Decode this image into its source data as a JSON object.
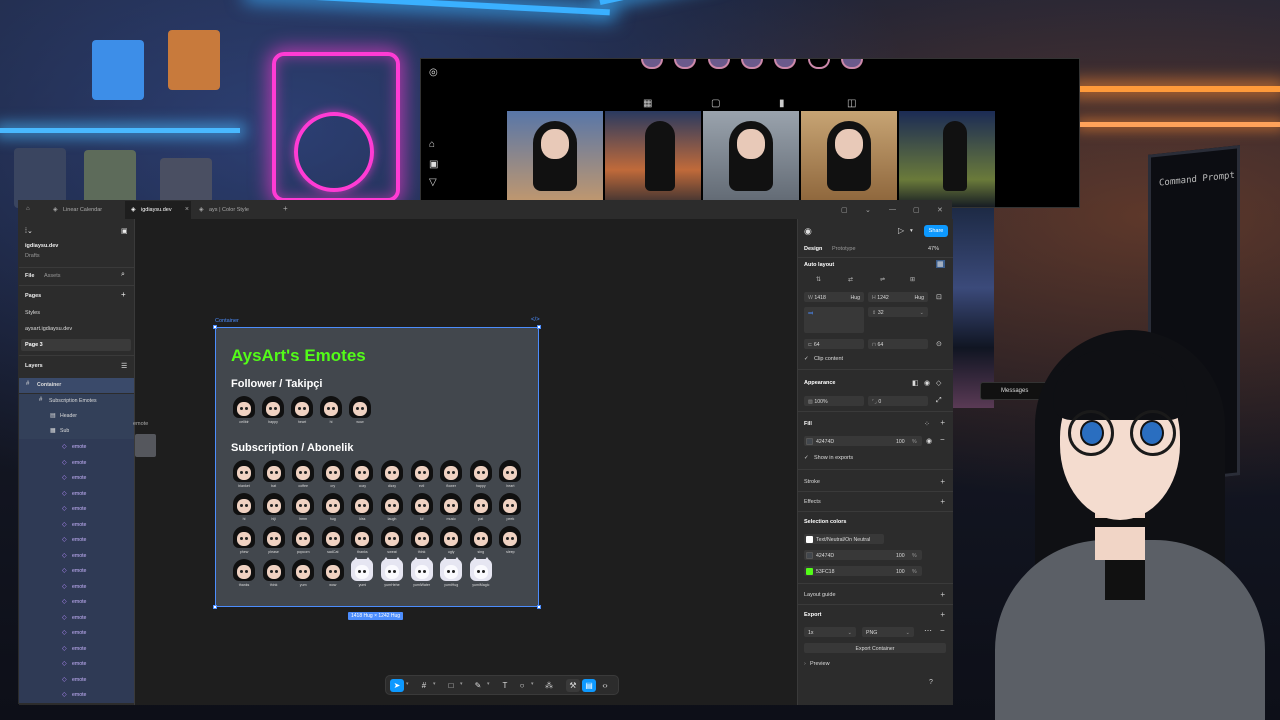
{
  "figma": {
    "tabs": [
      {
        "label": "Linear Calendar",
        "icon": "figma-icon"
      },
      {
        "label": "igdiaysu.dev",
        "icon": "figma-icon"
      },
      {
        "label": "ays | Color Style",
        "icon": "figma-icon"
      }
    ],
    "new_tab": "+",
    "left": {
      "project_name": "igdiaysu.dev",
      "project_sub": "Drafts",
      "tab_file": "File",
      "tab_assets": "Assets",
      "pages_label": "Pages",
      "pages": [
        "Styles",
        "aysart.igdiaysu.dev",
        "Page 3"
      ],
      "layers_label": "Layers",
      "layers": [
        {
          "label": "Container",
          "indent": 0
        },
        {
          "label": "Subscription Emotes",
          "indent": 1
        },
        {
          "label": "Header",
          "indent": 2
        },
        {
          "label": "Sub",
          "indent": 2
        }
      ],
      "emote_layer_label": "emote",
      "emote_layer_count": 17
    },
    "canvas": {
      "frame_label": "Container",
      "frame_code_icon": "</>",
      "ghost_label": "emote",
      "title": "AysArt's Emotes",
      "section1": "Follower / Takipçi",
      "follower_emotes": [
        "cellbir",
        "happy",
        "heart",
        "hi",
        "wow"
      ],
      "section2": "Subscription / Abonelik",
      "sub_rows": [
        [
          "blanket",
          "bat",
          "coffee",
          "cry",
          "cozy",
          "dizzy",
          "evil",
          "flower",
          "happy",
          "heart"
        ],
        [
          "hi",
          "hiji",
          "hmm",
          "hug",
          "kiss",
          "laugh",
          "lul",
          "music",
          "pat",
          "peek"
        ],
        [
          "phew",
          "please",
          "popcorn",
          "sadCat",
          "thanks",
          "sweat",
          "think",
          "ugly",
          "sing",
          "sleep"
        ],
        [
          "thanks",
          "think",
          "yum",
          "wow",
          "yumi",
          "yumHehe",
          "yumiWater",
          "yumiHug",
          "yumiMagic"
        ]
      ],
      "size_badge": "1418 Hug × 1242 Hug"
    },
    "right": {
      "tab_design": "Design",
      "tab_prototype": "Prototype",
      "zoom": "47%",
      "share": "Share",
      "autolayout_label": "Auto layout",
      "w_label": "W",
      "w_value": "1418",
      "w_mode": "Hug",
      "h_label": "H",
      "h_value": "1242",
      "h_mode": "Hug",
      "gap": "32",
      "pad_h": "64",
      "pad_v": "64",
      "clip": "Clip content",
      "appearance_label": "Appearance",
      "opacity": "100%",
      "radius": "0",
      "fill_label": "Fill",
      "fill_hex": "42474D",
      "fill_opacity": "100",
      "pct": "%",
      "show_exports": "Show in exports",
      "stroke_label": "Stroke",
      "effects_label": "Effects",
      "selection_colors_label": "Selection colors",
      "sel_colors": [
        {
          "name": "Text/Neutral/On Neutral",
          "hex": "#FFFFFF"
        },
        {
          "name": "42474D",
          "opacity": "100",
          "hex": "#42474D"
        },
        {
          "name": "53FC18",
          "opacity": "100",
          "hex": "#53FC18"
        }
      ],
      "layout_guide_label": "Layout guide",
      "export_label": "Export",
      "export_scale": "1x",
      "export_format": "PNG",
      "export_button": "Export Container",
      "preview_label": "Preview"
    },
    "toolbar": {
      "tools": [
        "move-tool-icon",
        "frame-tool-icon",
        "shape-tool-icon",
        "pen-tool-icon",
        "text-tool-icon",
        "comment-tool-icon",
        "actions-icon",
        "dev-mode-icon",
        "code-icon"
      ]
    },
    "help": "?"
  },
  "instagram": {
    "messages_label": "Messages"
  },
  "monitor": {
    "title": "Command Prompt"
  },
  "colors": {
    "accent": "#0d99ff",
    "selection": "#4c8dfd",
    "frame_fill": "#42474D",
    "title_green": "#53FC18"
  }
}
